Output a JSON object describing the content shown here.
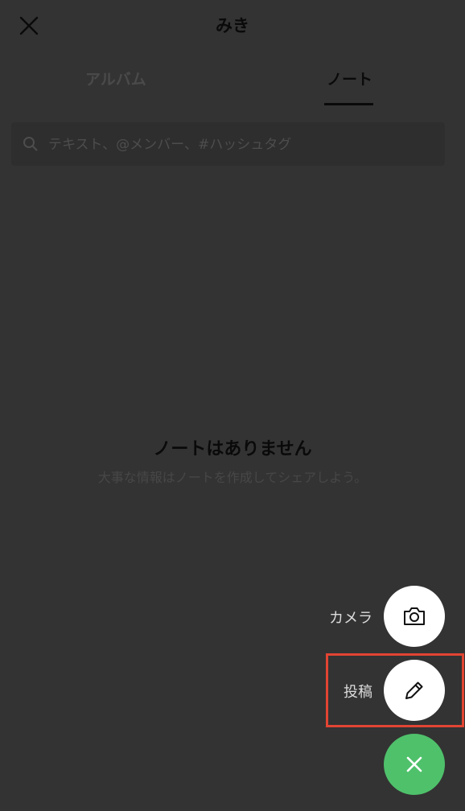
{
  "header": {
    "title": "みき"
  },
  "tabs": [
    {
      "label": "アルバム",
      "active": false
    },
    {
      "label": "ノート",
      "active": true
    }
  ],
  "search": {
    "placeholder": "テキスト、@メンバー、#ハッシュタグ"
  },
  "empty_state": {
    "title": "ノートはありません",
    "subtitle": "大事な情報はノートを作成してシェアしよう。"
  },
  "fab_menu": {
    "camera_label": "カメラ",
    "post_label": "投稿"
  },
  "colors": {
    "overlay_background": "#333333",
    "fab_accent": "#4fc16b",
    "highlight": "#e24433"
  }
}
